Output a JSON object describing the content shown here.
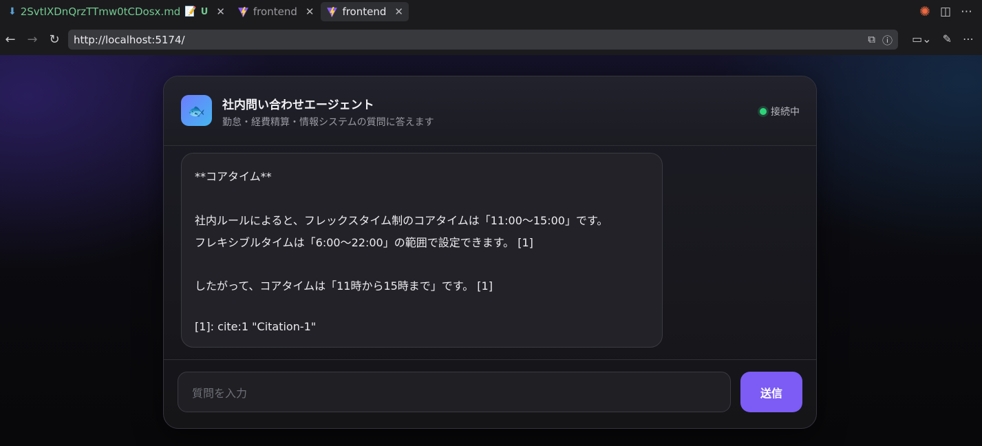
{
  "browser": {
    "tabs": [
      {
        "label": "2SvtIXDnQrzTTmw0tCDosx.md",
        "badge": "U",
        "icon": "download-arrow-icon",
        "active": false
      },
      {
        "label": "frontend",
        "icon": "vite-icon",
        "active": false
      },
      {
        "label": "frontend",
        "icon": "vite-icon",
        "active": true
      }
    ],
    "url": "http://localhost:5174/"
  },
  "header": {
    "avatar_icon": "🐟",
    "title": "社内問い合わせエージェント",
    "subtitle": "勤怠・経費精算・情報システムの質問に答えます",
    "status": "接続中",
    "status_color": "#2ed47a"
  },
  "messages": [
    {
      "role": "assistant",
      "lines": [
        "**コアタイム**",
        "",
        "社内ルールによると、フレックスタイム制のコアタイムは「11:00〜15:00」です。",
        "フレキシブルタイムは「6:00〜22:00」の範囲で設定できます。 [1]",
        "",
        "したがって、コアタイムは「11時から15時まで」です。 [1]",
        "",
        "[1]: cite:1 \"Citation-1\""
      ]
    }
  ],
  "composer": {
    "placeholder": "質問を入力",
    "send_label": "送信",
    "accent": "#7c5cf5"
  }
}
